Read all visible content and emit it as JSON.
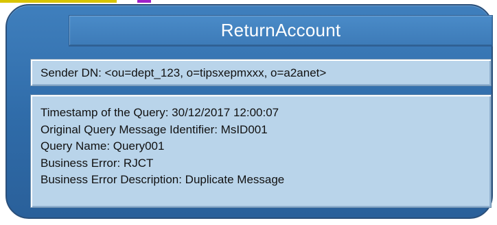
{
  "title": "ReturnAccount",
  "sender": "Sender DN: <ou=dept_123, o=tipsxepmxxx, o=a2anet>",
  "details": [
    "Timestamp of the Query: 30/12/2017 12:00:07",
    "Original Query Message Identifier: MsID001",
    "Query Name: Query001",
    "Business Error: RJCT",
    "Business Error Description: Duplicate Message"
  ],
  "colors": {
    "frame": "#2f6ba8",
    "title_bar": "#3d7bb8",
    "box_fill": "#b9d4ea",
    "strip_yellow": "#d9c400",
    "strip_purple": "#a020c8"
  }
}
